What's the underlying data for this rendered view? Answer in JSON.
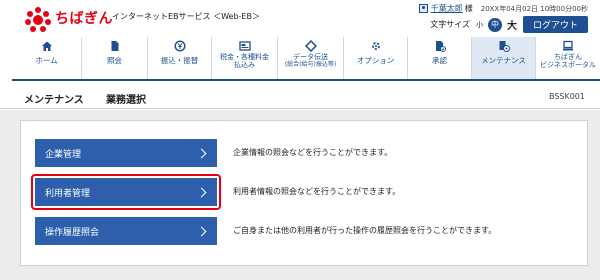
{
  "header": {
    "brand": "ちばぎん",
    "service": "インターネットEBサービス ＜Web-EB＞",
    "user_name": "千葉太郎",
    "user_suffix": "様",
    "login_time": "20XX年04月02日 10時00分00秒",
    "font_size_label": "文字サイズ",
    "font_small": "小",
    "font_medium": "中",
    "font_large": "大",
    "logout": "ログアウト"
  },
  "nav": [
    {
      "label": "ホーム",
      "icon": "home-icon"
    },
    {
      "label": "照会",
      "icon": "document-icon"
    },
    {
      "label": "振込・振替",
      "icon": "money-icon"
    },
    {
      "label": "税金・各種料金",
      "label2": "払込み",
      "icon": "payment-icon"
    },
    {
      "label": "データ伝送",
      "sub": "(総合(給与)振込等)",
      "icon": "data-transfer-icon"
    },
    {
      "label": "オプション",
      "icon": "options-icon"
    },
    {
      "label": "承認",
      "icon": "approval-icon"
    },
    {
      "label": "メンテナンス",
      "icon": "maintenance-icon",
      "active": true
    },
    {
      "label": "ちばぎん",
      "label2": "ビジネスポータル",
      "icon": "computer-icon"
    }
  ],
  "title_bar": {
    "title": "メンテナンス",
    "subtitle": "業務選択",
    "screen_id": "BSSK001"
  },
  "menu": [
    {
      "label": "企業管理",
      "description": "企業情報の照会などを行うことができます。"
    },
    {
      "label": "利用者管理",
      "description": "利用者情報の照会などを行うことができます。",
      "highlighted": true
    },
    {
      "label": "操作履歴照会",
      "description": "ご自身または他の利用者が行った操作の履歴照会を行うことができます。"
    }
  ],
  "colors": {
    "brand_red": "#e60012",
    "nav_blue": "#1d4f91",
    "button_blue": "#2d5fad",
    "highlight_red": "#e60012"
  }
}
